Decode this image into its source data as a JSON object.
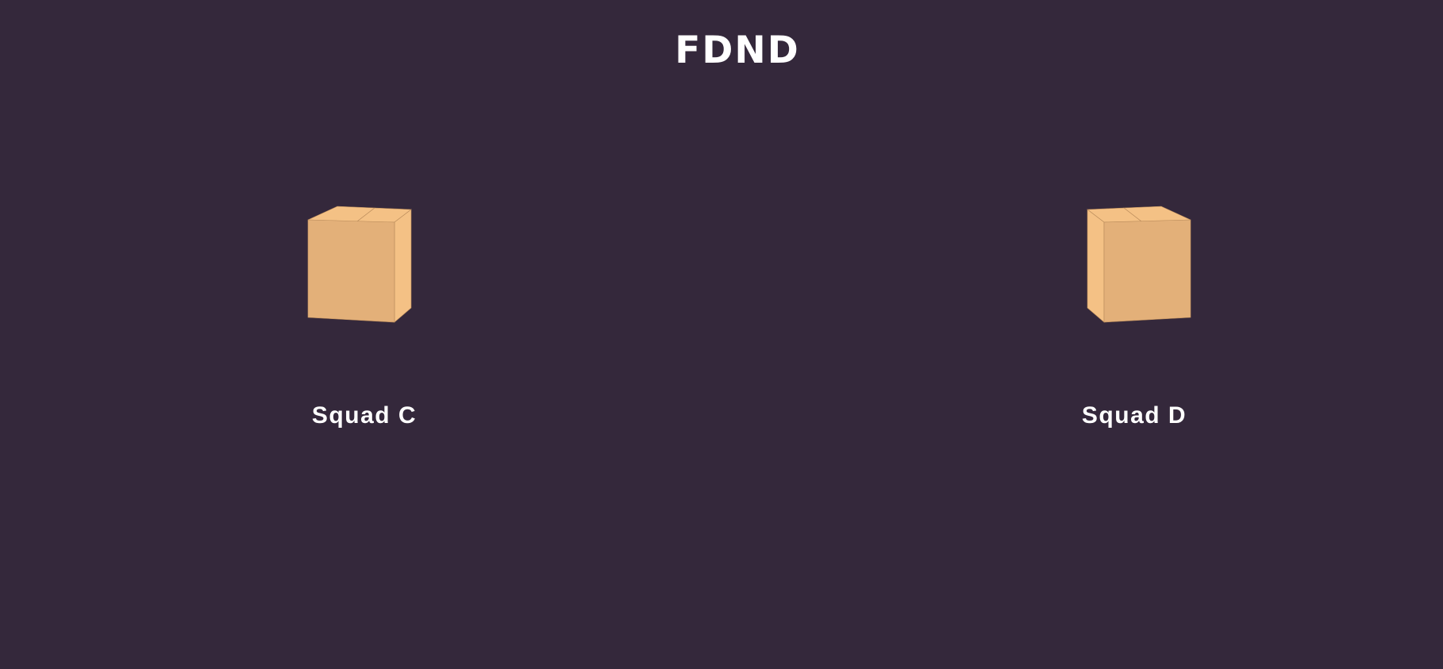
{
  "header": {
    "title": "FDND"
  },
  "squads": [
    {
      "label": "Squad C",
      "icon": "box-icon"
    },
    {
      "label": "Squad D",
      "icon": "box-icon"
    }
  ],
  "colors": {
    "background": "#34283b",
    "box_front": "#e3b079",
    "box_side": "#f4c185",
    "box_top": "#f4c185",
    "box_edge": "#b88a5a",
    "text": "#ffffff"
  }
}
